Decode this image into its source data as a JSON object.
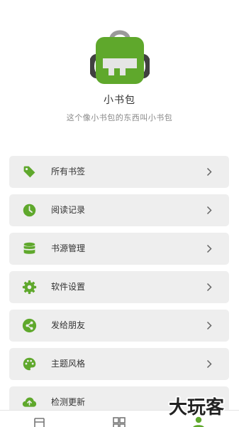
{
  "app": {
    "title": "小书包",
    "subtitle": "这个像小书包的东西叫小书包"
  },
  "menu": [
    {
      "label": "所有书签",
      "icon": "tag-icon"
    },
    {
      "label": "阅读记录",
      "icon": "clock-icon"
    },
    {
      "label": "书源管理",
      "icon": "database-icon"
    },
    {
      "label": "软件设置",
      "icon": "gear-icon"
    },
    {
      "label": "发给朋友",
      "icon": "share-icon"
    },
    {
      "label": "主题风格",
      "icon": "palette-icon"
    },
    {
      "label": "检测更新",
      "icon": "cloud-upload-icon"
    }
  ],
  "bottom_nav": [
    {
      "icon": "book-icon",
      "active": false
    },
    {
      "icon": "grid-icon",
      "active": false
    },
    {
      "icon": "person-icon",
      "active": true
    }
  ],
  "watermark": "大玩客",
  "colors": {
    "accent": "#5fa82c",
    "card": "#eeeeee",
    "text": "#333333",
    "subtext": "#888888",
    "chevron": "#666666"
  }
}
